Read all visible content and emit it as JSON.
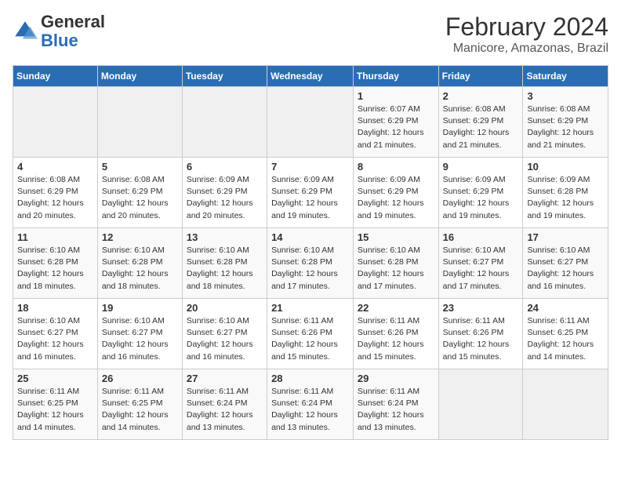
{
  "logo": {
    "general": "General",
    "blue": "Blue"
  },
  "header": {
    "month": "February 2024",
    "location": "Manicore, Amazonas, Brazil"
  },
  "days_of_week": [
    "Sunday",
    "Monday",
    "Tuesday",
    "Wednesday",
    "Thursday",
    "Friday",
    "Saturday"
  ],
  "weeks": [
    [
      {
        "day": "",
        "info": ""
      },
      {
        "day": "",
        "info": ""
      },
      {
        "day": "",
        "info": ""
      },
      {
        "day": "",
        "info": ""
      },
      {
        "day": "1",
        "info": "Sunrise: 6:07 AM\nSunset: 6:29 PM\nDaylight: 12 hours and 21 minutes."
      },
      {
        "day": "2",
        "info": "Sunrise: 6:08 AM\nSunset: 6:29 PM\nDaylight: 12 hours and 21 minutes."
      },
      {
        "day": "3",
        "info": "Sunrise: 6:08 AM\nSunset: 6:29 PM\nDaylight: 12 hours and 21 minutes."
      }
    ],
    [
      {
        "day": "4",
        "info": "Sunrise: 6:08 AM\nSunset: 6:29 PM\nDaylight: 12 hours and 20 minutes."
      },
      {
        "day": "5",
        "info": "Sunrise: 6:08 AM\nSunset: 6:29 PM\nDaylight: 12 hours and 20 minutes."
      },
      {
        "day": "6",
        "info": "Sunrise: 6:09 AM\nSunset: 6:29 PM\nDaylight: 12 hours and 20 minutes."
      },
      {
        "day": "7",
        "info": "Sunrise: 6:09 AM\nSunset: 6:29 PM\nDaylight: 12 hours and 19 minutes."
      },
      {
        "day": "8",
        "info": "Sunrise: 6:09 AM\nSunset: 6:29 PM\nDaylight: 12 hours and 19 minutes."
      },
      {
        "day": "9",
        "info": "Sunrise: 6:09 AM\nSunset: 6:29 PM\nDaylight: 12 hours and 19 minutes."
      },
      {
        "day": "10",
        "info": "Sunrise: 6:09 AM\nSunset: 6:28 PM\nDaylight: 12 hours and 19 minutes."
      }
    ],
    [
      {
        "day": "11",
        "info": "Sunrise: 6:10 AM\nSunset: 6:28 PM\nDaylight: 12 hours and 18 minutes."
      },
      {
        "day": "12",
        "info": "Sunrise: 6:10 AM\nSunset: 6:28 PM\nDaylight: 12 hours and 18 minutes."
      },
      {
        "day": "13",
        "info": "Sunrise: 6:10 AM\nSunset: 6:28 PM\nDaylight: 12 hours and 18 minutes."
      },
      {
        "day": "14",
        "info": "Sunrise: 6:10 AM\nSunset: 6:28 PM\nDaylight: 12 hours and 17 minutes."
      },
      {
        "day": "15",
        "info": "Sunrise: 6:10 AM\nSunset: 6:28 PM\nDaylight: 12 hours and 17 minutes."
      },
      {
        "day": "16",
        "info": "Sunrise: 6:10 AM\nSunset: 6:27 PM\nDaylight: 12 hours and 17 minutes."
      },
      {
        "day": "17",
        "info": "Sunrise: 6:10 AM\nSunset: 6:27 PM\nDaylight: 12 hours and 16 minutes."
      }
    ],
    [
      {
        "day": "18",
        "info": "Sunrise: 6:10 AM\nSunset: 6:27 PM\nDaylight: 12 hours and 16 minutes."
      },
      {
        "day": "19",
        "info": "Sunrise: 6:10 AM\nSunset: 6:27 PM\nDaylight: 12 hours and 16 minutes."
      },
      {
        "day": "20",
        "info": "Sunrise: 6:10 AM\nSunset: 6:27 PM\nDaylight: 12 hours and 16 minutes."
      },
      {
        "day": "21",
        "info": "Sunrise: 6:11 AM\nSunset: 6:26 PM\nDaylight: 12 hours and 15 minutes."
      },
      {
        "day": "22",
        "info": "Sunrise: 6:11 AM\nSunset: 6:26 PM\nDaylight: 12 hours and 15 minutes."
      },
      {
        "day": "23",
        "info": "Sunrise: 6:11 AM\nSunset: 6:26 PM\nDaylight: 12 hours and 15 minutes."
      },
      {
        "day": "24",
        "info": "Sunrise: 6:11 AM\nSunset: 6:25 PM\nDaylight: 12 hours and 14 minutes."
      }
    ],
    [
      {
        "day": "25",
        "info": "Sunrise: 6:11 AM\nSunset: 6:25 PM\nDaylight: 12 hours and 14 minutes."
      },
      {
        "day": "26",
        "info": "Sunrise: 6:11 AM\nSunset: 6:25 PM\nDaylight: 12 hours and 14 minutes."
      },
      {
        "day": "27",
        "info": "Sunrise: 6:11 AM\nSunset: 6:24 PM\nDaylight: 12 hours and 13 minutes."
      },
      {
        "day": "28",
        "info": "Sunrise: 6:11 AM\nSunset: 6:24 PM\nDaylight: 12 hours and 13 minutes."
      },
      {
        "day": "29",
        "info": "Sunrise: 6:11 AM\nSunset: 6:24 PM\nDaylight: 12 hours and 13 minutes."
      },
      {
        "day": "",
        "info": ""
      },
      {
        "day": "",
        "info": ""
      }
    ]
  ]
}
